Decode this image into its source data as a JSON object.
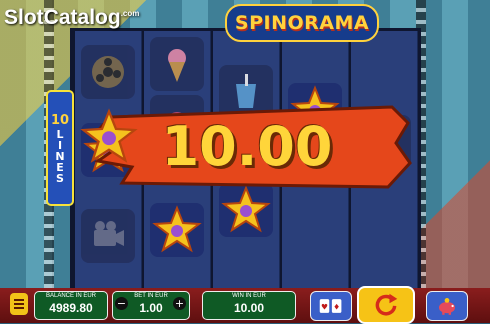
{
  "watermark": {
    "brand_left": "Slot",
    "brand_right": "Catalog",
    "suffix": ".com"
  },
  "game": {
    "title": "SPINORAMA"
  },
  "lines_indicator": {
    "count": "10",
    "label": "LINES"
  },
  "win_display": {
    "amount": "10.00"
  },
  "balance": {
    "caption": "BALANCE IN EUR",
    "value": "4989.80"
  },
  "bet": {
    "caption": "BET IN EUR",
    "value": "1.00",
    "decrease_symbol": "−",
    "increase_symbol": "+"
  },
  "win": {
    "caption": "WIN IN EUR",
    "value": "10.00"
  },
  "icons": {
    "menu": "menu-icon",
    "cards": "cards-icon",
    "spin": "spin-arrow-icon",
    "autoplay": "piggy-bank-icon"
  },
  "colors": {
    "accent_yellow": "#ffd23d",
    "panel_green": "#0f5a25",
    "bar_red": "#8a1d1d",
    "banner_orange": "#e5471b"
  }
}
